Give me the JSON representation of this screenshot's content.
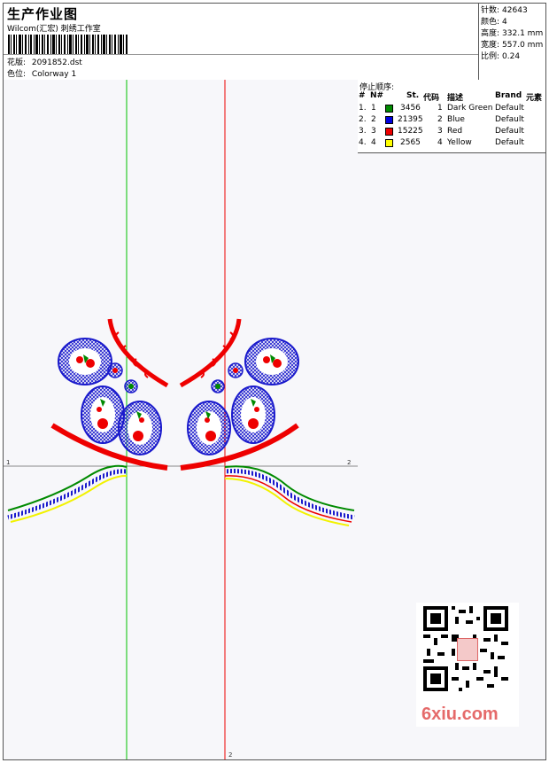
{
  "header": {
    "title": "生产作业图",
    "company": "Wilcom(汇宏) 刺绣工作室",
    "file_label": "花版:",
    "file_name": "2091852.dst",
    "colorway_label": "色位:",
    "colorway_name": "Colorway 1"
  },
  "stats": [
    {
      "label": "针数:",
      "value": "42643"
    },
    {
      "label": "颜色:",
      "value": "4"
    },
    {
      "label": "高度:",
      "value": "332.1 mm"
    },
    {
      "label": "宽度:",
      "value": "557.0 mm"
    },
    {
      "label": "比例:",
      "value": "0.24"
    }
  ],
  "sequence": {
    "title": "停止顺序:",
    "headers": {
      "num": "#",
      "n": "N#",
      "st": "St.",
      "code": "代码",
      "desc": "描述",
      "brand": "Brand",
      "elem": "元素"
    },
    "rows": [
      {
        "num": "1.",
        "n": "1",
        "st": "3456",
        "code": "1",
        "desc": "Dark Green",
        "brand": "Default",
        "color": "#008a00"
      },
      {
        "num": "2.",
        "n": "2",
        "st": "21395",
        "code": "2",
        "desc": "Blue",
        "brand": "Default",
        "color": "#0000dd"
      },
      {
        "num": "3.",
        "n": "3",
        "st": "15225",
        "code": "3",
        "desc": "Red",
        "brand": "Default",
        "color": "#ee0000"
      },
      {
        "num": "4.",
        "n": "4",
        "st": "2565",
        "code": "4",
        "desc": "Yellow",
        "brand": "Default",
        "color": "#ffff00"
      }
    ]
  },
  "canvas": {
    "marker_left": "1",
    "marker_right": "2",
    "marker_bottom": "2"
  },
  "watermark": {
    "text": "6xiu.com"
  },
  "colors": {
    "green": "#008a00",
    "blue": "#1a1acc",
    "red": "#ee0000",
    "yellow": "#f2f200"
  }
}
